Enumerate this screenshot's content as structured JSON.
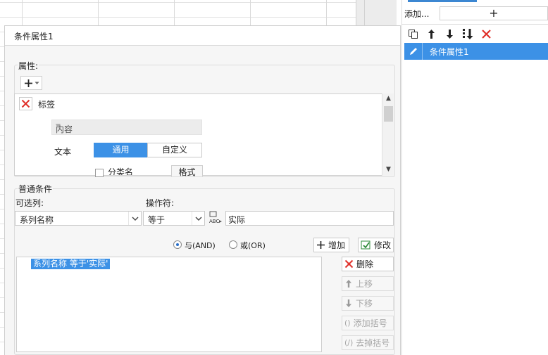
{
  "right_panel": {
    "add_label": "添加...",
    "add_symbol": "+",
    "toolbar_icons": [
      "copy-icon",
      "arrow-up-icon",
      "arrow-down-icon",
      "move-bottom-icon",
      "delete-icon"
    ],
    "items": [
      {
        "label": "条件属性1",
        "selected": true
      }
    ]
  },
  "dialog": {
    "title": "条件属性1",
    "properties": {
      "section_title": "属性:",
      "add_symbol": "+",
      "item_label": "标签",
      "content_placeholder": "内容",
      "text_label": "文本",
      "segment_options": [
        "通用",
        "自定义"
      ],
      "segment_selected": "通用",
      "checkbox_label": "分类名",
      "format_button": "格式"
    },
    "conditions": {
      "section_title": "普通条件",
      "column_label": "可选列:",
      "column_value": "系列名称",
      "operator_label": "操作符:",
      "operator_value": "等于",
      "value_text": "实际",
      "radio_and": "与(AND)",
      "radio_or": "或(OR)",
      "radio_selected": "and",
      "add_button": "增加",
      "modify_button": "修改",
      "list": [
        "系列名称 等于'实际'"
      ],
      "delete_button": "删除",
      "move_up_button": "上移",
      "move_down_button": "下移",
      "add_bracket_button": "添加括号",
      "remove_bracket_button": "去掉括号"
    }
  },
  "colors": {
    "accent": "#3c91e6",
    "delete_red": "#e0302a",
    "dialog_bg": "#f6f6f6"
  }
}
